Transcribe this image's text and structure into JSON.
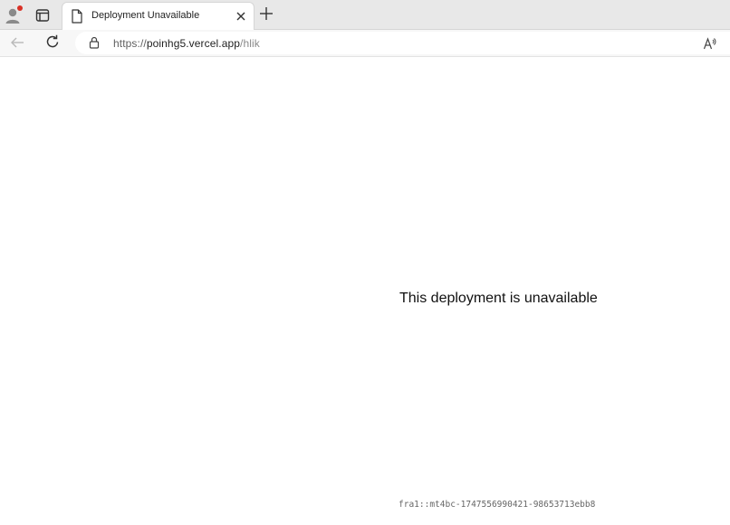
{
  "browser": {
    "tab": {
      "title": "Deployment Unavailable"
    },
    "address": {
      "scheme": "https://",
      "host": "poinhg5.vercel.app",
      "path": "/hlik"
    },
    "icons": {
      "profile": "profile-icon",
      "tabs": "tab-actions-icon",
      "page": "page-icon",
      "close": "close-icon",
      "new_tab": "plus-icon",
      "back": "back-arrow-icon",
      "reload": "reload-icon",
      "lock": "lock-icon",
      "read_aloud": "read-aloud-icon"
    },
    "colors": {
      "notification_dot": "#d93025",
      "tabstrip_bg": "#e8e8e8",
      "toolbar_bg": "#f7f7f7"
    }
  },
  "page": {
    "message": "This deployment is unavailable",
    "error_id": "fra1::mt4bc-1747556990421-98653713ebb8"
  }
}
